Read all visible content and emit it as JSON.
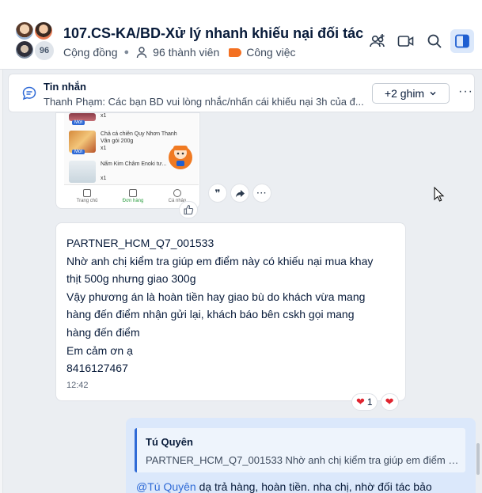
{
  "header": {
    "title": "107.CS-KA/BD-Xử lý nhanh khiếu nại đối tác",
    "member_badge": "96",
    "community_label": "Cộng đồng",
    "members_label": "96 thành viên",
    "task_label": "Công việc",
    "accent_color": "#f37021"
  },
  "pinned": {
    "title": "Tin nhắn",
    "preview": "Thanh Phạm: Các bạn BD vui lòng nhắc/nhấn cái khiếu nại 3h của đ...",
    "pins_button": "+2 ghim",
    "more": "···"
  },
  "image_card": {
    "badge": "Mới",
    "products": [
      {
        "name": "",
        "qty": "x1"
      },
      {
        "name": "Chả cá chiên Quy Nhơn Thanh Vân gói 200g",
        "qty": "x1"
      },
      {
        "name": "Nấm Kim Châm Enoki tư...",
        "qty": "x1"
      }
    ],
    "nav": [
      "Trang chủ",
      "Đơn hàng",
      "Cá nhân"
    ]
  },
  "message": {
    "lines": [
      "PARTNER_HCM_Q7_001533",
      "Nhờ anh chị kiểm tra giúp em điểm này có khiếu nại mua khay",
      "thịt 500g nhưng giao 300g",
      "Vậy phương án là hoàn tiền hay giao bù do khách vừa mang",
      "hàng đến điểm nhận gửi lại, khách báo bên cskh gọi mang",
      "hàng đến điểm",
      "Em cảm ơn ạ",
      "8416127467"
    ],
    "time": "12:42",
    "reaction_count": "1"
  },
  "reply": {
    "quote_author": "Tú Quyên",
    "quote_text": "PARTNER_HCM_Q7_001533 Nhờ anh chị kiểm tra giúp em điểm nà...",
    "mention": "@Tú Quyên",
    "text": " dạ trả hàng, hoàn tiền. nha chị, nhờ đối tác bảo"
  }
}
